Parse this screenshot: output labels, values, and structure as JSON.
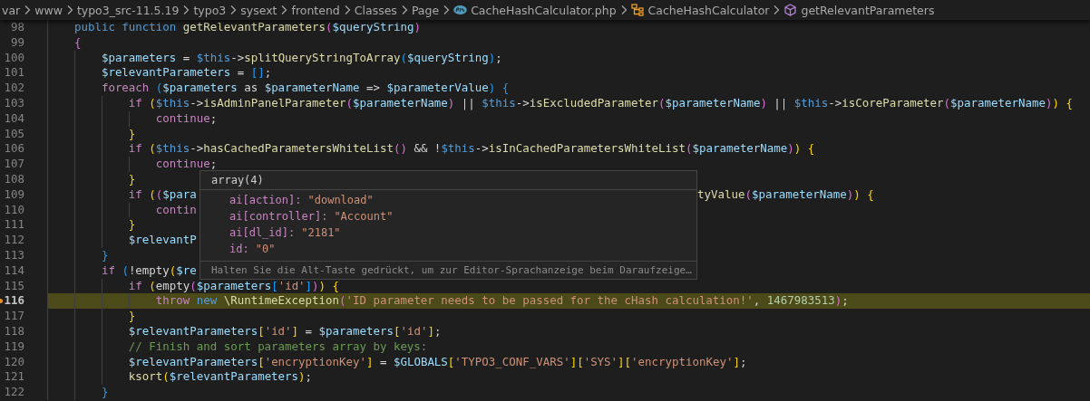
{
  "breadcrumbs": [
    {
      "label": "var",
      "kind": "folder"
    },
    {
      "label": "www",
      "kind": "folder"
    },
    {
      "label": "typo3_src-11.5.19",
      "kind": "folder"
    },
    {
      "label": "typo3",
      "kind": "folder"
    },
    {
      "label": "sysext",
      "kind": "folder"
    },
    {
      "label": "frontend",
      "kind": "folder"
    },
    {
      "label": "Classes",
      "kind": "folder"
    },
    {
      "label": "Page",
      "kind": "folder"
    },
    {
      "label": "CacheHashCalculator.php",
      "kind": "php-file"
    },
    {
      "label": "CacheHashCalculator",
      "kind": "class"
    },
    {
      "label": "getRelevantParameters",
      "kind": "method"
    }
  ],
  "editor": {
    "lines": [
      {
        "number": "98",
        "highlighted": false,
        "segments": [
          [
            {
              "text": "    public function ",
              "kind": "storage"
            },
            {
              "text": "getRelevantParameters",
              "kind": "function"
            },
            {
              "text": "(",
              "kind": "bracket2"
            },
            {
              "text": "$queryString",
              "kind": "variable"
            },
            {
              "text": ")",
              "kind": "bracket2"
            }
          ]
        ]
      },
      {
        "number": "99",
        "highlighted": false,
        "segments": [
          [
            {
              "text": "    {",
              "kind": "bracket2"
            }
          ]
        ]
      },
      {
        "number": "100",
        "highlighted": false,
        "segments": [
          [
            {
              "text": "        $parameters",
              "kind": "variable"
            },
            {
              "text": " = ",
              "kind": "plain"
            },
            {
              "text": "$this",
              "kind": "storage"
            },
            {
              "text": "->",
              "kind": "plain"
            },
            {
              "text": "splitQueryStringToArray",
              "kind": "function"
            },
            {
              "text": "(",
              "kind": "bracket3"
            },
            {
              "text": "$queryString",
              "kind": "variable"
            },
            {
              "text": ")",
              "kind": "bracket3"
            },
            {
              "text": ";",
              "kind": "plain"
            }
          ]
        ]
      },
      {
        "number": "101",
        "highlighted": false,
        "segments": [
          [
            {
              "text": "        $relevantParameters",
              "kind": "variable"
            },
            {
              "text": " = ",
              "kind": "plain"
            },
            {
              "text": "[]",
              "kind": "bracket3"
            },
            {
              "text": ";",
              "kind": "plain"
            }
          ]
        ]
      },
      {
        "number": "102",
        "highlighted": false,
        "segments": [
          [
            {
              "text": "        foreach ",
              "kind": "keyword"
            },
            {
              "text": "(",
              "kind": "bracket3"
            },
            {
              "text": "$parameters",
              "kind": "variable"
            },
            {
              "text": " as ",
              "kind": "plain"
            },
            {
              "text": "$parameterName",
              "kind": "variable"
            },
            {
              "text": " => ",
              "kind": "plain"
            },
            {
              "text": "$parameterValue",
              "kind": "variable"
            },
            {
              "text": ")",
              "kind": "bracket3"
            },
            {
              "text": " {",
              "kind": "bracket3"
            }
          ]
        ]
      },
      {
        "number": "103",
        "highlighted": false,
        "segments": [
          [
            {
              "text": "            if ",
              "kind": "keyword"
            },
            {
              "text": "(",
              "kind": "bracket1"
            },
            {
              "text": "$this",
              "kind": "storage"
            },
            {
              "text": "->",
              "kind": "plain"
            },
            {
              "text": "isAdminPanelParameter",
              "kind": "function"
            },
            {
              "text": "(",
              "kind": "bracket2"
            },
            {
              "text": "$parameterName",
              "kind": "variable"
            },
            {
              "text": ")",
              "kind": "bracket2"
            },
            {
              "text": " || ",
              "kind": "plain"
            },
            {
              "text": "$this",
              "kind": "storage"
            },
            {
              "text": "->",
              "kind": "plain"
            },
            {
              "text": "isExcludedParameter",
              "kind": "function"
            },
            {
              "text": "(",
              "kind": "bracket2"
            },
            {
              "text": "$parameterName",
              "kind": "variable"
            },
            {
              "text": ")",
              "kind": "bracket2"
            },
            {
              "text": " || ",
              "kind": "plain"
            },
            {
              "text": "$this",
              "kind": "storage"
            },
            {
              "text": "->",
              "kind": "plain"
            },
            {
              "text": "isCoreParameter",
              "kind": "function"
            },
            {
              "text": "(",
              "kind": "bracket2"
            },
            {
              "text": "$parameterName",
              "kind": "variable"
            },
            {
              "text": ")",
              "kind": "bracket2"
            },
            {
              "text": ")",
              "kind": "bracket1"
            },
            {
              "text": " {",
              "kind": "bracket1"
            }
          ]
        ]
      },
      {
        "number": "104",
        "highlighted": false,
        "segments": [
          [
            {
              "text": "                continue",
              "kind": "keyword"
            },
            {
              "text": ";",
              "kind": "plain"
            }
          ]
        ]
      },
      {
        "number": "105",
        "highlighted": false,
        "segments": [
          [
            {
              "text": "            }",
              "kind": "bracket1"
            }
          ]
        ]
      },
      {
        "number": "106",
        "highlighted": false,
        "segments": [
          [
            {
              "text": "            if ",
              "kind": "keyword"
            },
            {
              "text": "(",
              "kind": "bracket1"
            },
            {
              "text": "$this",
              "kind": "storage"
            },
            {
              "text": "->",
              "kind": "plain"
            },
            {
              "text": "hasCachedParametersWhiteList",
              "kind": "function"
            },
            {
              "text": "()",
              "kind": "bracket2"
            },
            {
              "text": " && !",
              "kind": "plain"
            },
            {
              "text": "$this",
              "kind": "storage"
            },
            {
              "text": "->",
              "kind": "plain"
            },
            {
              "text": "isInCachedParametersWhiteList",
              "kind": "function"
            },
            {
              "text": "(",
              "kind": "bracket2"
            },
            {
              "text": "$parameterName",
              "kind": "variable"
            },
            {
              "text": ")",
              "kind": "bracket2"
            },
            {
              "text": ")",
              "kind": "bracket1"
            },
            {
              "text": " {",
              "kind": "bracket1"
            }
          ]
        ]
      },
      {
        "number": "107",
        "highlighted": false,
        "segments": [
          [
            {
              "text": "                continue",
              "kind": "keyword"
            },
            {
              "text": ";",
              "kind": "plain"
            }
          ]
        ]
      },
      {
        "number": "108",
        "highlighted": false,
        "segments": [
          [
            {
              "text": "            }",
              "kind": "bracket1"
            }
          ]
        ]
      },
      {
        "number": "109",
        "highlighted": false,
        "segments": [
          [
            {
              "text": "            if ",
              "kind": "keyword"
            },
            {
              "text": "(",
              "kind": "bracket1"
            },
            {
              "text": "(",
              "kind": "bracket2"
            },
            {
              "text": "$para",
              "kind": "variable"
            }
          ],
          [
            {
              "text": "tyValue",
              "kind": "function"
            },
            {
              "text": "(",
              "kind": "bracket2"
            },
            {
              "text": "$parameterName",
              "kind": "variable"
            },
            {
              "text": ")",
              "kind": "bracket2"
            },
            {
              "text": ")",
              "kind": "bracket1"
            },
            {
              "text": " {",
              "kind": "bracket1"
            }
          ]
        ]
      },
      {
        "number": "110",
        "highlighted": false,
        "segments": [
          [
            {
              "text": "                contin",
              "kind": "keyword"
            }
          ]
        ]
      },
      {
        "number": "111",
        "highlighted": false,
        "segments": [
          [
            {
              "text": "            }",
              "kind": "bracket1"
            }
          ]
        ]
      },
      {
        "number": "112",
        "highlighted": false,
        "segments": [
          [
            {
              "text": "            $relevantP",
              "kind": "variable"
            }
          ]
        ]
      },
      {
        "number": "113",
        "highlighted": false,
        "segments": [
          [
            {
              "text": "        }",
              "kind": "bracket3"
            }
          ]
        ]
      },
      {
        "number": "114",
        "highlighted": false,
        "segments": [
          [
            {
              "text": "        if ",
              "kind": "keyword"
            },
            {
              "text": "(",
              "kind": "bracket3"
            },
            {
              "text": "!empty",
              "kind": "plain"
            },
            {
              "text": "(",
              "kind": "bracket1"
            },
            {
              "text": "$re",
              "kind": "variable"
            }
          ]
        ]
      },
      {
        "number": "115",
        "highlighted": false,
        "segments": [
          [
            {
              "text": "            if ",
              "kind": "keyword"
            },
            {
              "text": "(",
              "kind": "bracket1"
            },
            {
              "text": "empty",
              "kind": "plain"
            },
            {
              "text": "(",
              "kind": "bracket2"
            },
            {
              "text": "$parameters",
              "kind": "variable"
            },
            {
              "text": "[",
              "kind": "bracket3"
            },
            {
              "text": "'id'",
              "kind": "string"
            },
            {
              "text": "]",
              "kind": "bracket3"
            },
            {
              "text": ")",
              "kind": "bracket2"
            },
            {
              "text": ")",
              "kind": "bracket1"
            },
            {
              "text": " {",
              "kind": "bracket1"
            }
          ]
        ]
      },
      {
        "number": "116",
        "highlighted": true,
        "segments": [
          [
            {
              "text": "                throw ",
              "kind": "keyword"
            },
            {
              "text": "new ",
              "kind": "storage"
            },
            {
              "text": "\\RuntimeException",
              "kind": "class"
            },
            {
              "text": "(",
              "kind": "bracket2"
            },
            {
              "text": "'ID parameter needs to be passed for the cHash calculation!'",
              "kind": "string"
            },
            {
              "text": ", ",
              "kind": "plain"
            },
            {
              "text": "1467983513",
              "kind": "number"
            },
            {
              "text": ")",
              "kind": "bracket2"
            },
            {
              "text": ";",
              "kind": "plain"
            }
          ]
        ]
      },
      {
        "number": "117",
        "highlighted": false,
        "segments": [
          [
            {
              "text": "            }",
              "kind": "bracket1"
            }
          ]
        ]
      },
      {
        "number": "118",
        "highlighted": false,
        "segments": [
          [
            {
              "text": "            $relevantParameters",
              "kind": "variable"
            },
            {
              "text": "[",
              "kind": "bracket1"
            },
            {
              "text": "'id'",
              "kind": "string"
            },
            {
              "text": "]",
              "kind": "bracket1"
            },
            {
              "text": " = ",
              "kind": "plain"
            },
            {
              "text": "$parameters",
              "kind": "variable"
            },
            {
              "text": "[",
              "kind": "bracket1"
            },
            {
              "text": "'id'",
              "kind": "string"
            },
            {
              "text": "]",
              "kind": "bracket1"
            },
            {
              "text": ";",
              "kind": "plain"
            }
          ]
        ]
      },
      {
        "number": "119",
        "highlighted": false,
        "segments": [
          [
            {
              "text": "            // Finish and sort parameters array by keys:",
              "kind": "comment"
            }
          ]
        ]
      },
      {
        "number": "120",
        "highlighted": false,
        "segments": [
          [
            {
              "text": "            $relevantParameters",
              "kind": "variable"
            },
            {
              "text": "[",
              "kind": "bracket1"
            },
            {
              "text": "'encryptionKey'",
              "kind": "string"
            },
            {
              "text": "]",
              "kind": "bracket1"
            },
            {
              "text": " = ",
              "kind": "plain"
            },
            {
              "text": "$GLOBALS",
              "kind": "variable"
            },
            {
              "text": "[",
              "kind": "bracket1"
            },
            {
              "text": "'TYPO3_CONF_VARS'",
              "kind": "string"
            },
            {
              "text": "]",
              "kind": "bracket1"
            },
            {
              "text": "[",
              "kind": "bracket1"
            },
            {
              "text": "'SYS'",
              "kind": "string"
            },
            {
              "text": "]",
              "kind": "bracket1"
            },
            {
              "text": "[",
              "kind": "bracket1"
            },
            {
              "text": "'encryptionKey'",
              "kind": "string"
            },
            {
              "text": "]",
              "kind": "bracket1"
            },
            {
              "text": ";",
              "kind": "plain"
            }
          ]
        ]
      },
      {
        "number": "121",
        "highlighted": false,
        "segments": [
          [
            {
              "text": "            ksort",
              "kind": "function"
            },
            {
              "text": "(",
              "kind": "bracket1"
            },
            {
              "text": "$relevantParameters",
              "kind": "variable"
            },
            {
              "text": ")",
              "kind": "bracket1"
            },
            {
              "text": ";",
              "kind": "plain"
            }
          ]
        ]
      },
      {
        "number": "122",
        "highlighted": false,
        "segments": [
          [
            {
              "text": "        }",
              "kind": "bracket3"
            }
          ]
        ]
      }
    ]
  },
  "hover": {
    "title": "array(4)",
    "entries": [
      {
        "key": "ai[action]:",
        "value": "\"download\""
      },
      {
        "key": "ai[controller]:",
        "value": "\"Account\""
      },
      {
        "key": "ai[dl_id]:",
        "value": "\"2181\""
      },
      {
        "key": "id:",
        "value": "\"0\""
      }
    ],
    "hint": "Halten Sie die Alt-Taste gedrückt, um zur Editor-Sprachanzeige beim Daraufzeige…"
  }
}
